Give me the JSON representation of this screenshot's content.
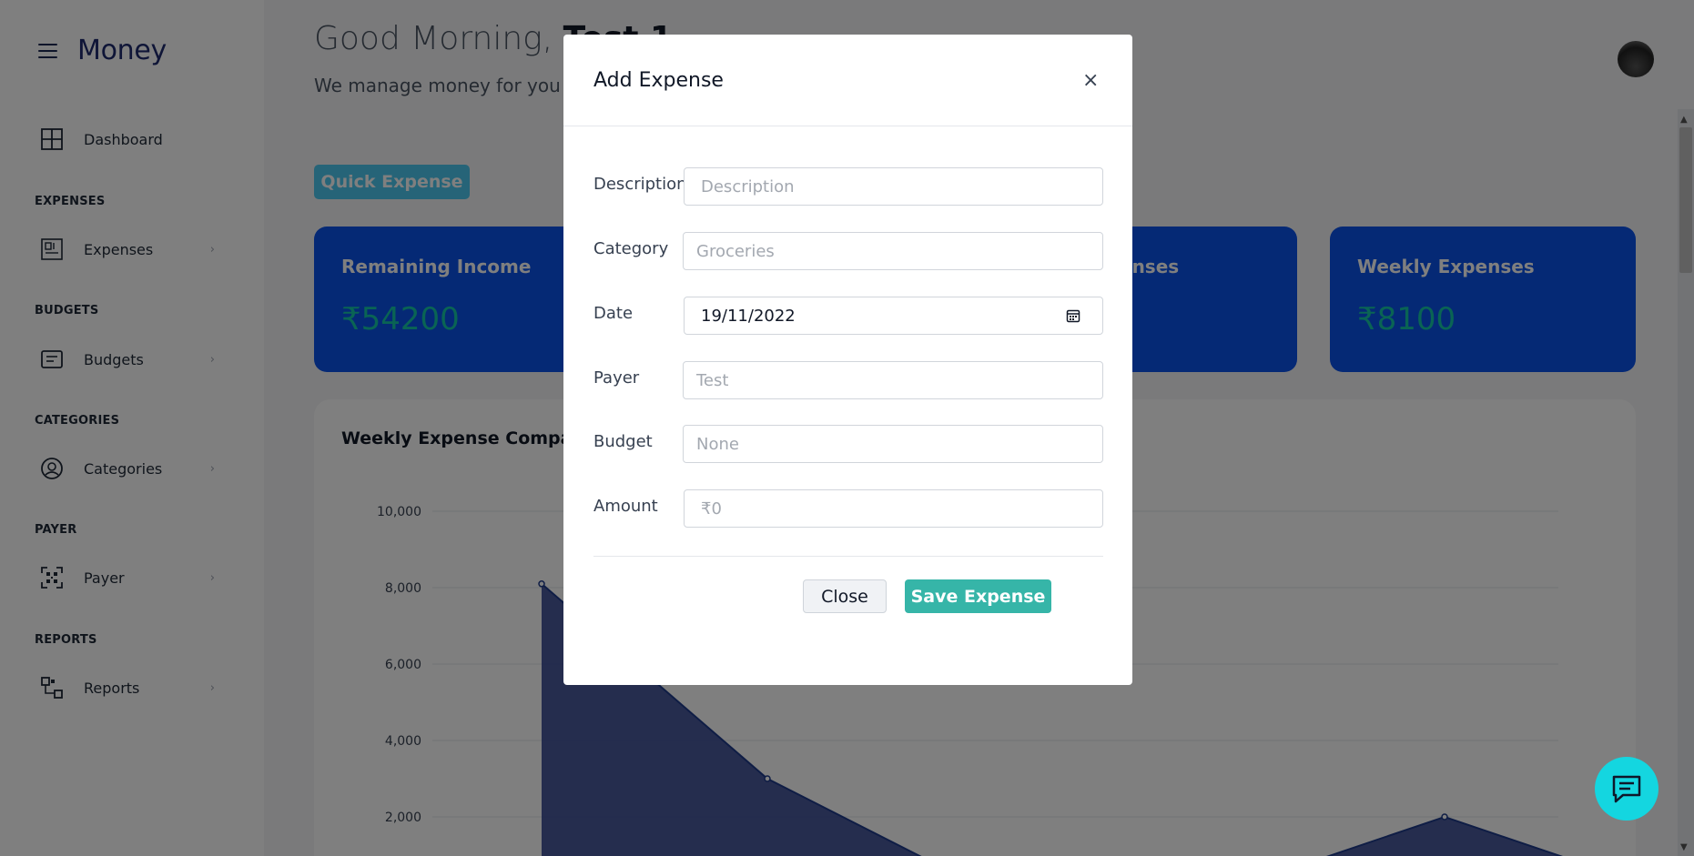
{
  "app": {
    "name": "Money"
  },
  "sidebar": {
    "dashboard": "Dashboard",
    "sections": [
      {
        "heading": "EXPENSES",
        "item": "Expenses"
      },
      {
        "heading": "BUDGETS",
        "item": "Budgets"
      },
      {
        "heading": "CATEGORIES",
        "item": "Categories"
      },
      {
        "heading": "PAYER",
        "item": "Payer"
      },
      {
        "heading": "REPORTS",
        "item": "Reports"
      }
    ],
    "chevron": "›"
  },
  "header": {
    "greeting_prefix": "Good Morning,",
    "user_name": "Test 1",
    "subtitle": "We manage money for you !"
  },
  "quick_expense_label": "Quick Expense",
  "cards": [
    {
      "title": "Remaining Income",
      "value": "₹54200"
    },
    {
      "title": "Weekly Expenses",
      "value": "₹8100"
    }
  ],
  "card_partial_title": "enses",
  "chart_section": {
    "title": "Weekly Expense Comparison"
  },
  "chart_data": {
    "type": "area",
    "ylim": [
      0,
      10000
    ],
    "yticks": [
      "10,000",
      "8,000",
      "6,000",
      "4,000",
      "2,000"
    ],
    "points": [
      {
        "x": 1,
        "y": 8100
      },
      {
        "x": 2,
        "y": 3000
      },
      {
        "x": 3,
        "y": 0
      },
      {
        "x": 4,
        "y": 0
      },
      {
        "x": 5,
        "y": 2000
      },
      {
        "x": 6,
        "y": 0
      }
    ],
    "color": "#2c3e8c"
  },
  "modal": {
    "title": "Add Expense",
    "close_symbol": "×",
    "fields": {
      "description": {
        "label": "Description",
        "placeholder": "Description",
        "value": ""
      },
      "category": {
        "label": "Category",
        "placeholder": "Groceries",
        "value": ""
      },
      "date": {
        "label": "Date",
        "value": "19/11/2022"
      },
      "payer": {
        "label": "Payer",
        "placeholder": "Test",
        "value": ""
      },
      "budget": {
        "label": "Budget",
        "placeholder": "None",
        "value": ""
      },
      "amount": {
        "label": "Amount",
        "placeholder": "₹0",
        "value": ""
      }
    },
    "close_button": "Close",
    "save_button": "Save Expense"
  }
}
